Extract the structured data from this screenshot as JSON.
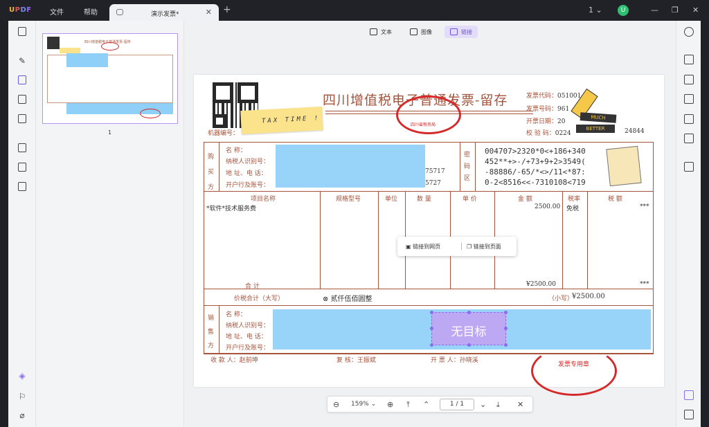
{
  "app": {
    "logo": "UPDF",
    "menu": [
      "文件",
      "帮助"
    ],
    "tab_title": "演示发票*",
    "page_count_indicator": "1",
    "avatar": "U"
  },
  "toolbar": {
    "text": "文本",
    "image": "图像",
    "link": "链接"
  },
  "thumbnail": {
    "page_number": "1"
  },
  "invoice": {
    "title": "四川增值税电子普通发票-留存",
    "sticky": "TAX TIME !",
    "code_label": "发票代码：",
    "code_value": "051001",
    "number_label": "发票号码：",
    "number_value": "961",
    "date_label": "开票日期：",
    "date_value": "20",
    "check_label": "校 验 码：",
    "check_value_a": "0224",
    "check_value_b": "24844",
    "machine_label": "机器编号：",
    "buyer_section": "购买方",
    "buyer_fields": [
      "名    称：",
      "纳税人识别号：",
      "地 址、电 话：",
      "开户行及账号："
    ],
    "buyer_tail1": "75717",
    "buyer_tail2": "5727",
    "password_section": "密码区",
    "cipher": [
      "004707>2320*0<+186+340",
      "452**+>-/+73+9+2>3549(",
      "-88886/-65/*<>/11<*87:",
      "0-2<8516<<-7310108<719"
    ],
    "headers": [
      "项目名称",
      "规格型号",
      "单位",
      "数  量",
      "单  价",
      "金  额",
      "税率",
      "税  额"
    ],
    "item_name": "*软件*技术服务费",
    "amount": "2500.00",
    "tax_rate": "免税",
    "tax_amount": "***",
    "total_label": "合    计",
    "total_amount": "¥2500.00",
    "total_tax": "***",
    "summary_label": "价税合计（大写）",
    "summary_words": "贰仟伍佰圆整",
    "summary_small_label": "（小写）",
    "summary_small_value": "¥2500.00",
    "seller_section": "销售方",
    "seller_fields": [
      "名    称：",
      "纳税人识别号：",
      "地 址、电 话：",
      "开户行及账号："
    ],
    "payee": "收 款 人：赵前坤",
    "reviewer": "复  核：王振斌",
    "issuer": "开 票 人：孙晓溪",
    "seal_text": "发票专用章",
    "stamp_text": "四川省税务局",
    "sticker_much": "MUCH",
    "sticker_better": "BETTER"
  },
  "link_popup": {
    "to_web": "链接到网页",
    "to_page": "链接到页面"
  },
  "link_box": {
    "label": "无目标"
  },
  "zoom": {
    "value": "159%",
    "page": "1",
    "total": "1"
  }
}
